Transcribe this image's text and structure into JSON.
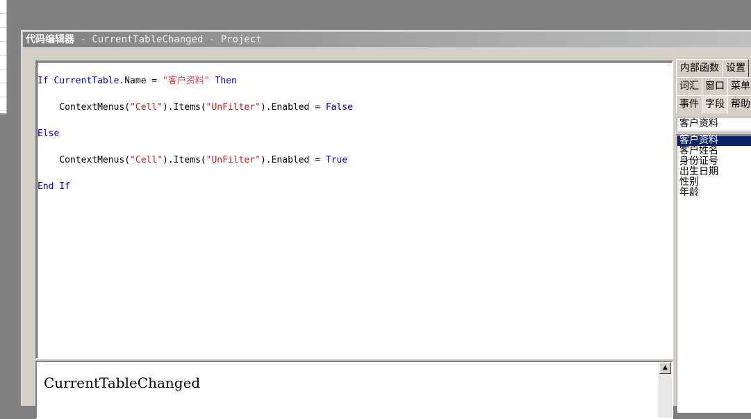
{
  "window": {
    "app_name": "代码编辑器",
    "separator": " - ",
    "event_name": "CurrentTableChanged",
    "project": "Project"
  },
  "code": {
    "line1": {
      "kw_if": "If",
      "obj": "CurrentTable",
      "member": ".Name = ",
      "str": "\"客户资料\"",
      "kw_then": "Then"
    },
    "line2": {
      "indent": "    ",
      "call": "ContextMenus(",
      "str1": "\"Cell\"",
      "mid": ").Items(",
      "str2": "\"UnFilter\"",
      "tail": ").Enabled = ",
      "val": "False"
    },
    "line3": {
      "kw": "Else"
    },
    "line4": {
      "indent": "    ",
      "call": "ContextMenus(",
      "str1": "\"Cell\"",
      "mid": ").Items(",
      "str2": "\"UnFilter\"",
      "tail": ").Enabled = ",
      "val": "True"
    },
    "line5": {
      "kw": "End If"
    }
  },
  "lower_panel": {
    "title": "CurrentTableChanged",
    "scroll_up_glyph": "▲"
  },
  "side_tabs": {
    "row1": [
      "内部函数",
      "设置"
    ],
    "row2": [
      "词汇",
      "窗口",
      "菜单"
    ],
    "row3": [
      "事件",
      "字段",
      "帮助"
    ],
    "active": "字段"
  },
  "fields": {
    "current_table": "客户资料",
    "items": [
      "客户资料",
      "客户姓名",
      "身份证号",
      "出生日期",
      "性别",
      "年龄"
    ],
    "selected_index": 0
  },
  "colors": {
    "keyword": "#0000c0",
    "string": "#c02020",
    "selection": "#0a246a"
  }
}
